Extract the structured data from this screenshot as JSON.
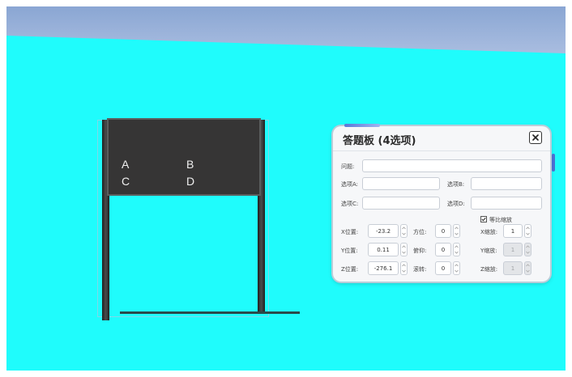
{
  "board": {
    "letters": {
      "a": "A",
      "b": "B",
      "c": "C",
      "d": "D"
    }
  },
  "dialog": {
    "title": "答题板 (4选项)",
    "labels": {
      "question": "问题:",
      "option_a": "选项A:",
      "option_b": "选项B:",
      "option_c": "选项C:",
      "option_d": "选项D:",
      "uniform_scale": "等比缩放",
      "x_pos": "X位置:",
      "y_pos": "Y位置:",
      "z_pos": "Z位置:",
      "yaw": "方位:",
      "pitch": "俯仰:",
      "roll": "滚转:",
      "x_scale": "X缩放:",
      "y_scale": "Y缩放:",
      "z_scale": "Z缩放:"
    },
    "values": {
      "question": "",
      "option_a": "",
      "option_b": "",
      "option_c": "",
      "option_d": "",
      "uniform_scale_checked": true,
      "x_pos": "-23.2",
      "y_pos": "0.11",
      "z_pos": "-276.1",
      "yaw": "0",
      "pitch": "0",
      "roll": "0",
      "x_scale": "1",
      "y_scale": "1",
      "z_scale": "1"
    },
    "disabled": [
      "y_scale",
      "z_scale"
    ]
  },
  "icons": {
    "close": "close-x-icon",
    "spinner": "spinner-arrows-icon",
    "check": "checkmark-icon"
  },
  "colors": {
    "scene_bg": "#1ffcfc",
    "sky_top": "#8aa6d3",
    "board_panel": "#363535",
    "post": "#2d2f2f",
    "dialog_bg": "#f6f7f9"
  }
}
